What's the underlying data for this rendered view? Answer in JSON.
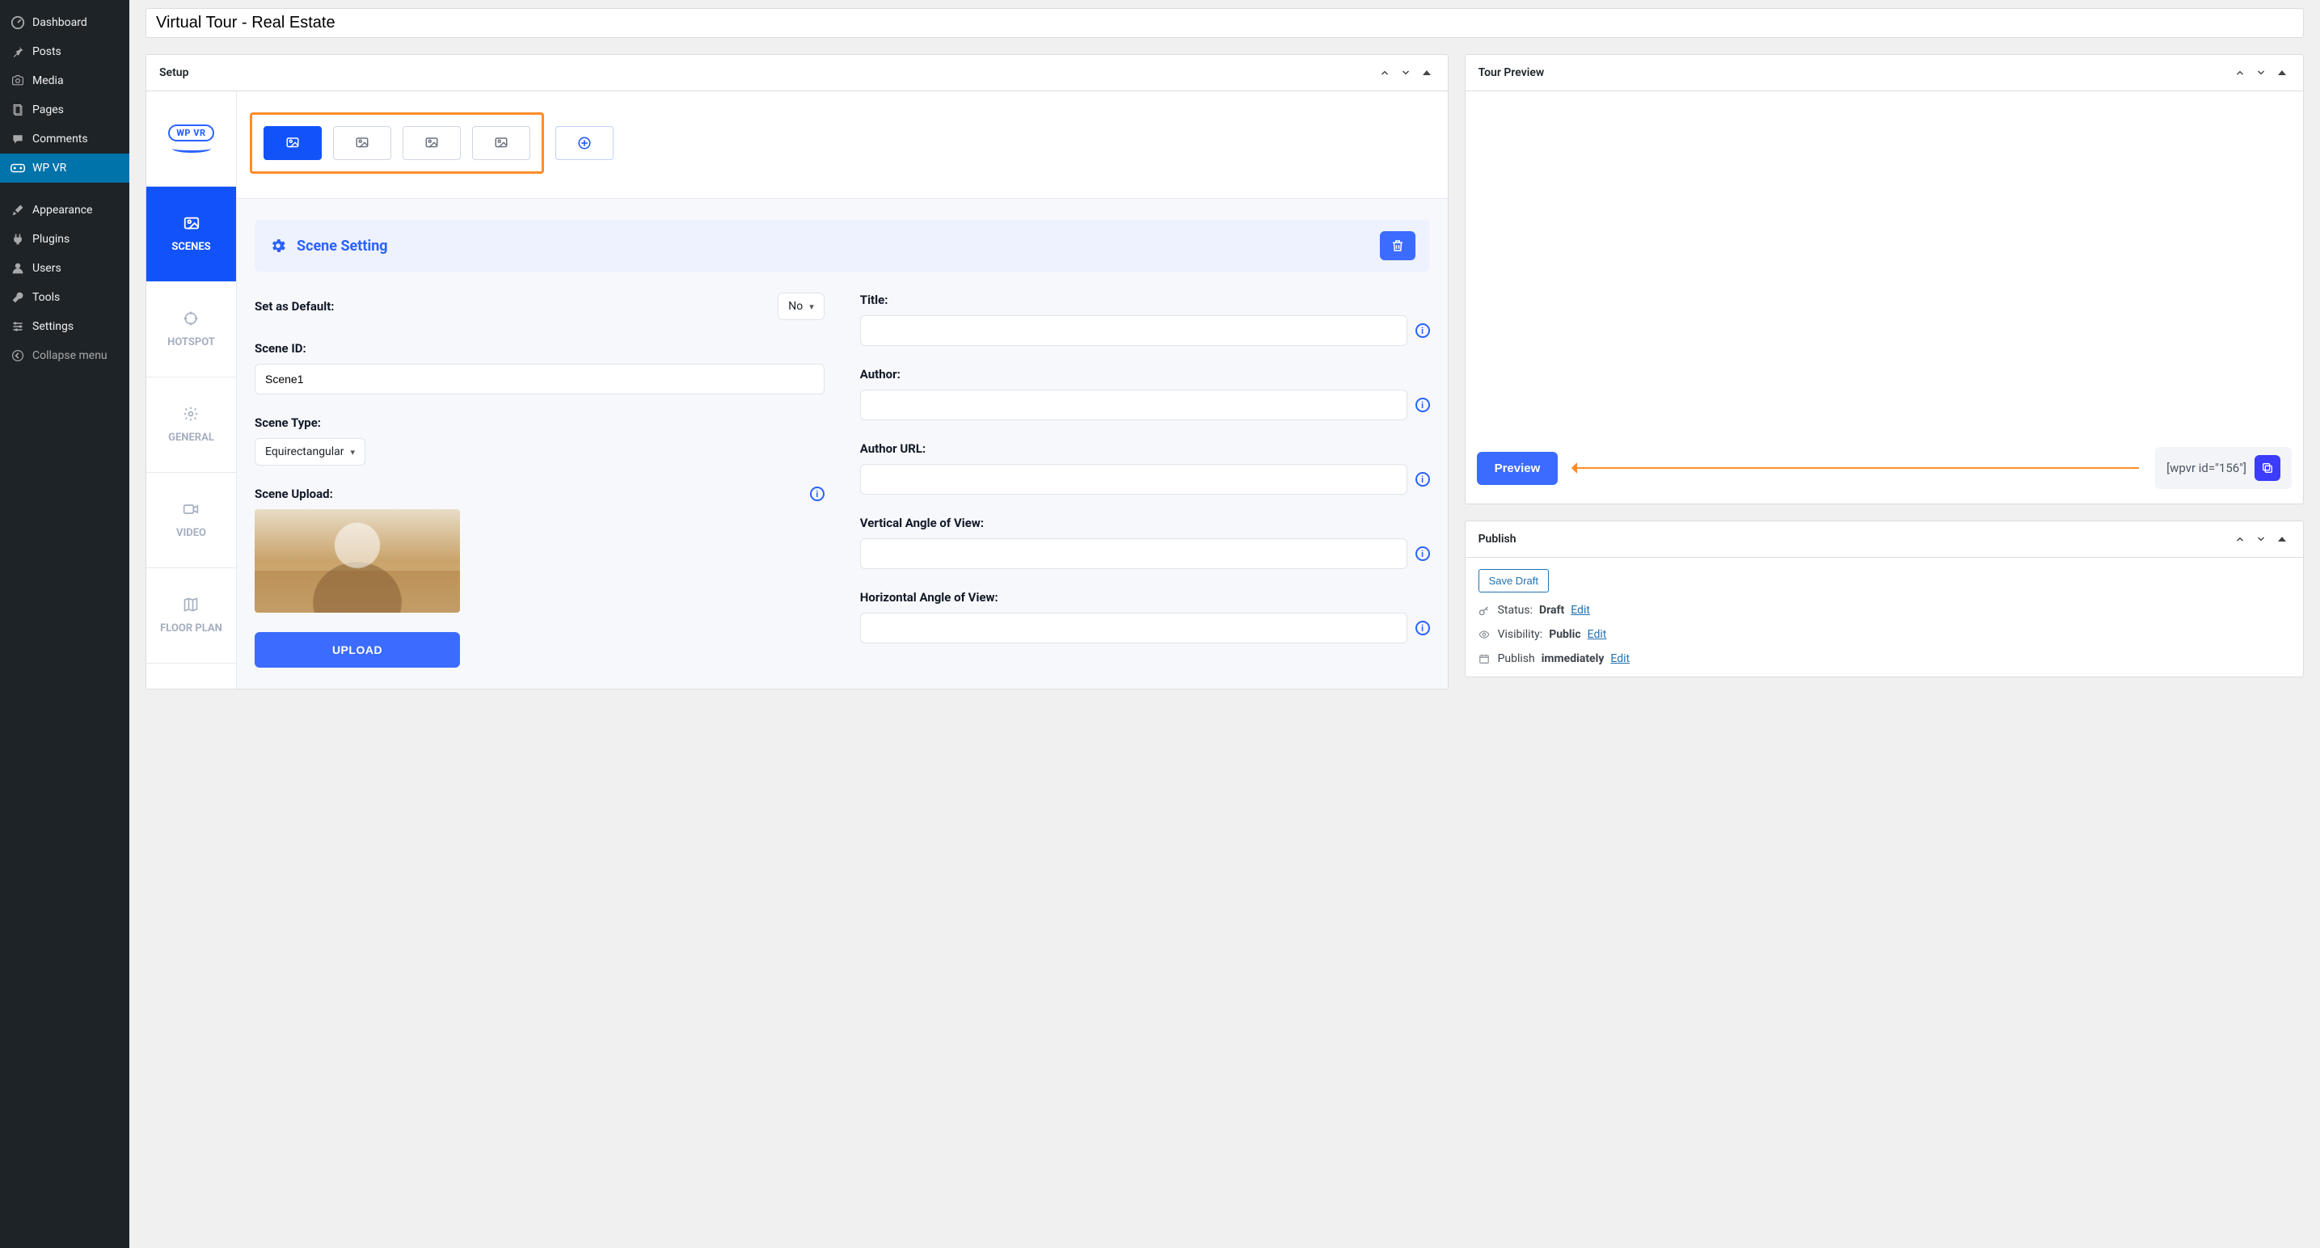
{
  "title": "Virtual Tour - Real Estate",
  "sidebar": {
    "items": [
      {
        "label": "Dashboard"
      },
      {
        "label": "Posts"
      },
      {
        "label": "Media"
      },
      {
        "label": "Pages"
      },
      {
        "label": "Comments"
      },
      {
        "label": "WP VR"
      },
      {
        "label": "Appearance"
      },
      {
        "label": "Plugins"
      },
      {
        "label": "Users"
      },
      {
        "label": "Tools"
      },
      {
        "label": "Settings"
      },
      {
        "label": "Collapse menu"
      }
    ]
  },
  "setup": {
    "title": "Setup",
    "logo_text": "WP VR",
    "tabs": {
      "scenes": "SCENES",
      "hotspot": "HOTSPOT",
      "general": "GENERAL",
      "video": "VIDEO",
      "floorplan": "FLOOR PLAN"
    },
    "scene_setting_title": "Scene Setting",
    "fields": {
      "set_default_label": "Set as Default:",
      "set_default_value": "No",
      "scene_id_label": "Scene ID:",
      "scene_id_value": "Scene1",
      "scene_type_label": "Scene Type:",
      "scene_type_value": "Equirectangular",
      "scene_upload_label": "Scene Upload:",
      "upload_button": "UPLOAD",
      "title_label": "Title:",
      "title_value": "",
      "author_label": "Author:",
      "author_value": "",
      "author_url_label": "Author URL:",
      "author_url_value": "",
      "vaov_label": "Vertical Angle of View:",
      "vaov_value": "",
      "haov_label": "Horizontal Angle of View:",
      "haov_value": ""
    }
  },
  "tour_preview": {
    "title": "Tour Preview",
    "preview_button": "Preview",
    "shortcode": "[wpvr id=\"156\"]"
  },
  "publish": {
    "title": "Publish",
    "save_draft": "Save Draft",
    "status_label": "Status:",
    "status_value": "Draft",
    "visibility_label": "Visibility:",
    "visibility_value": "Public",
    "schedule_label": "Publish",
    "schedule_value": "immediately",
    "edit": "Edit"
  }
}
